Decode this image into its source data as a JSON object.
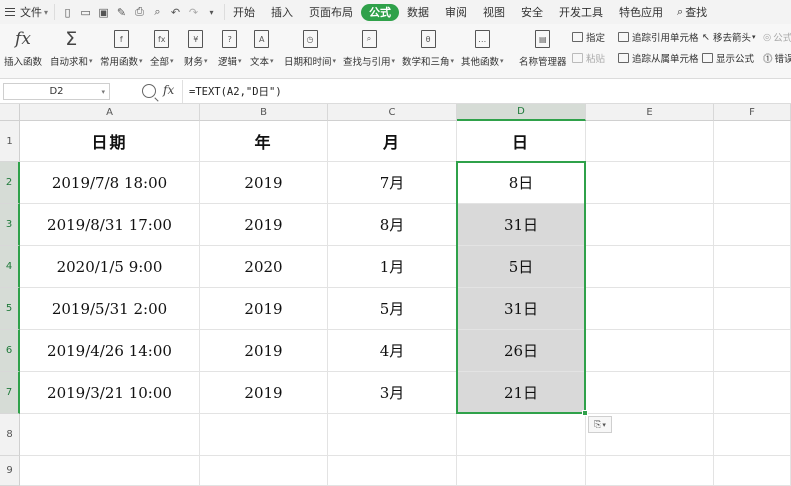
{
  "menu": {
    "file_label": "文件",
    "tabs": [
      "开始",
      "插入",
      "页面布局",
      "公式",
      "数据",
      "审阅",
      "视图",
      "安全",
      "开发工具",
      "特色应用"
    ],
    "active_tab": "公式",
    "search_label": "查找"
  },
  "ribbon": {
    "insert_function": "插入函数",
    "autosum": "自动求和",
    "common_functions": "常用函数",
    "all": "全部",
    "financial": "财务",
    "logical": "逻辑",
    "text": "文本",
    "datetime": "日期和时间",
    "lookup": "查找与引用",
    "math": "数学和三角",
    "other": "其他函数",
    "name_manager": "名称管理器",
    "specify": "指定",
    "paste": "粘贴",
    "trace_precedents": "追踪引用单元格",
    "trace_dependents": "追踪从属单元格",
    "remove_arrows": "移去箭头",
    "show_formulas": "显示公式",
    "formula_eval": "公式",
    "error_check": "错误"
  },
  "formula_bar": {
    "name_box": "D2",
    "fx": "fx",
    "formula": "=TEXT(A2,\"D日\")"
  },
  "columns": [
    "A",
    "B",
    "C",
    "D",
    "E",
    "F"
  ],
  "row_numbers": [
    "1",
    "2",
    "3",
    "4",
    "5",
    "6",
    "7",
    "8",
    "9"
  ],
  "table": {
    "headers": [
      "日期",
      "年",
      "月",
      "日"
    ],
    "rows": [
      [
        "2019/7/8 18:00",
        "2019",
        "7月",
        "8日"
      ],
      [
        "2019/8/31 17:00",
        "2019",
        "8月",
        "31日"
      ],
      [
        "2020/1/5 9:00",
        "2020",
        "1月",
        "5日"
      ],
      [
        "2019/5/31 2:00",
        "2019",
        "5月",
        "31日"
      ],
      [
        "2019/4/26 14:00",
        "2019",
        "4月",
        "26日"
      ],
      [
        "2019/3/21 10:00",
        "2019",
        "3月",
        "21日"
      ]
    ]
  },
  "colors": {
    "accent_green": "#2fa14a",
    "selection_fill": "#d9d9d9"
  }
}
